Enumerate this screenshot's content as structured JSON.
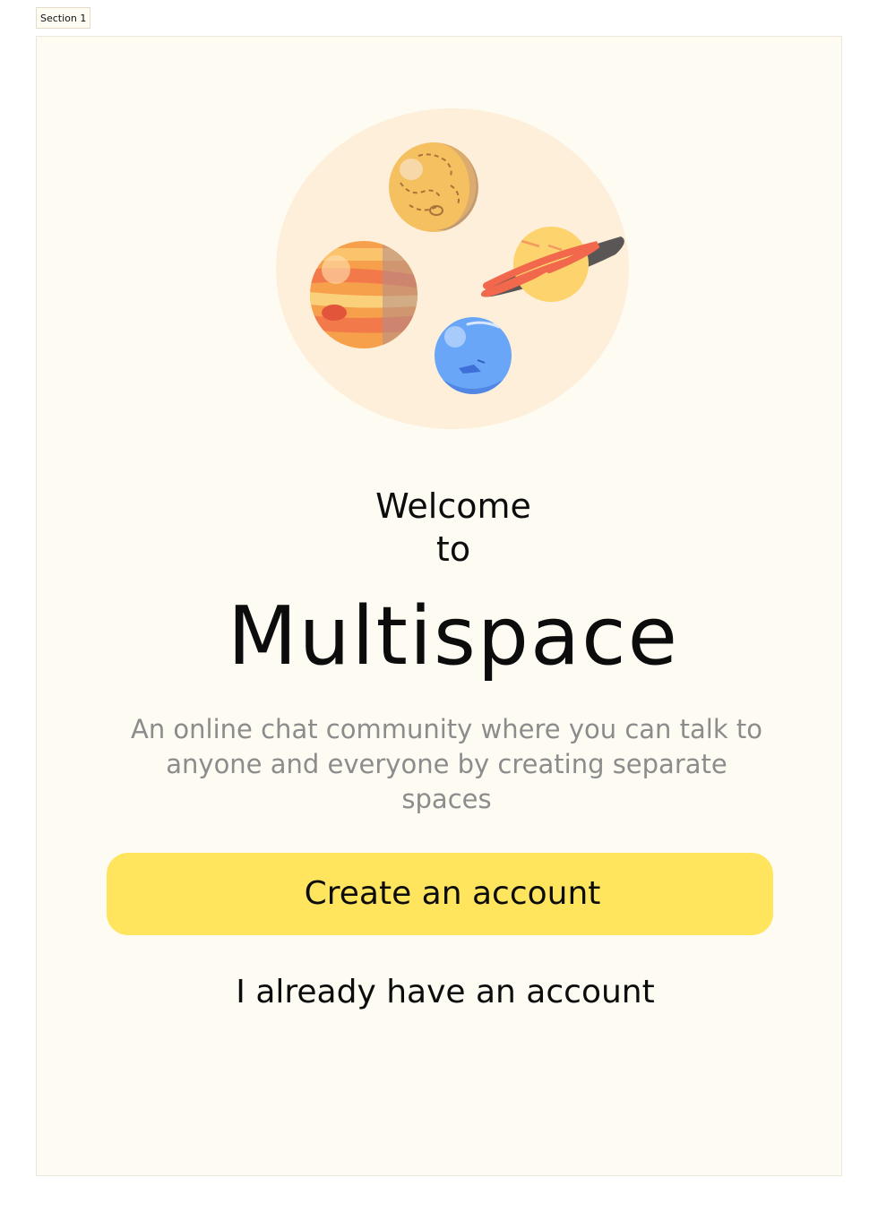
{
  "section_label": "Section 1",
  "welcome": {
    "line1": "Welcome",
    "line2": "to"
  },
  "brand_name": "Multispace",
  "tagline": "An online chat community where you can talk to anyone and everyone by creating separate spaces",
  "primary_button_label": "Create an account",
  "secondary_link_label": "I already have an account",
  "colors": {
    "background": "#fefbf2",
    "illustration_bg": "#fdefd9",
    "primary_button": "#ffe55d",
    "text_dark": "#0c0c0c",
    "text_muted": "#8c8c8c"
  },
  "icons": [
    "planets-illustration",
    "venus-planet",
    "jupiter-planet",
    "saturn-planet",
    "neptune-planet"
  ]
}
